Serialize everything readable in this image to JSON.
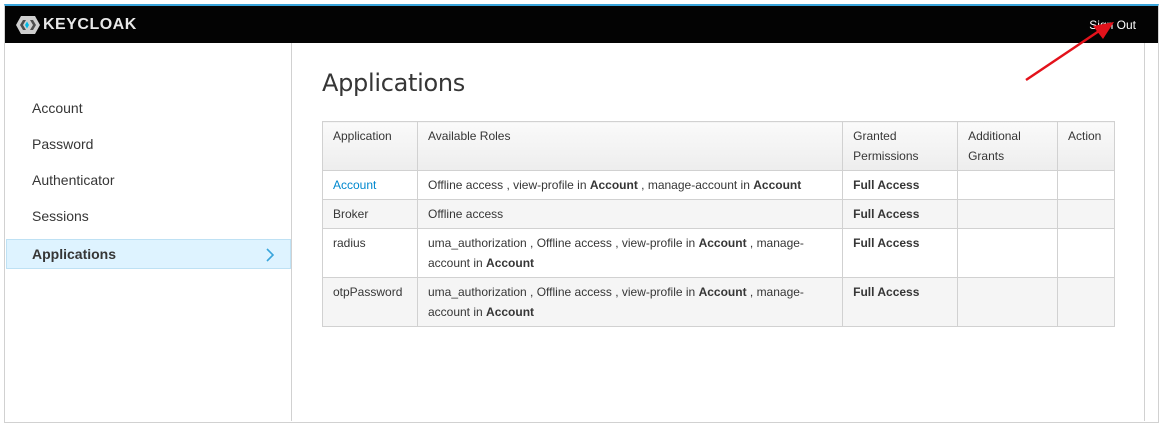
{
  "header": {
    "logo_text": "KEYCLOAK",
    "sign_out": "Sign Out"
  },
  "sidebar": {
    "items": [
      {
        "label": "Account",
        "active": false
      },
      {
        "label": "Password",
        "active": false
      },
      {
        "label": "Authenticator",
        "active": false
      },
      {
        "label": "Sessions",
        "active": false
      },
      {
        "label": "Applications",
        "active": true
      }
    ]
  },
  "main": {
    "title": "Applications",
    "table": {
      "headers": {
        "application": "Application",
        "available_roles": "Available Roles",
        "granted_line1": "Granted",
        "granted_line2": "Permissions",
        "additional_line1": "Additional",
        "additional_line2": "Grants",
        "action": "Action"
      },
      "rows": [
        {
          "application": "Account",
          "roles_parts": [
            "Offline access , view-profile in ",
            "Account",
            " , manage-account in ",
            "Account"
          ],
          "granted": "Full Access",
          "additional": "",
          "action": ""
        },
        {
          "application": "Broker",
          "roles_parts": [
            "Offline access"
          ],
          "granted": "Full Access",
          "additional": "",
          "action": ""
        },
        {
          "application": "radius",
          "roles_parts": [
            "uma_authorization , Offline access , view-profile in ",
            "Account",
            " , manage-account in ",
            "Account"
          ],
          "granted": "Full Access",
          "additional": "",
          "action": ""
        },
        {
          "application": "otpPassword",
          "roles_parts": [
            "uma_authorization , Offline access , view-profile in ",
            "Account",
            " , manage-account in ",
            "Account"
          ],
          "granted": "Full Access",
          "additional": "",
          "action": ""
        }
      ]
    }
  },
  "colors": {
    "topbar": "#030303",
    "accent_border": "#39a5dc",
    "active_nav_bg": "#def3ff",
    "link": "#0088ce",
    "annotation_arrow": "#e3121b"
  },
  "icons": {
    "logo": "keycloak-logo-icon",
    "nav_active": "chevron-right-icon",
    "annotation": "red-arrow-icon"
  }
}
